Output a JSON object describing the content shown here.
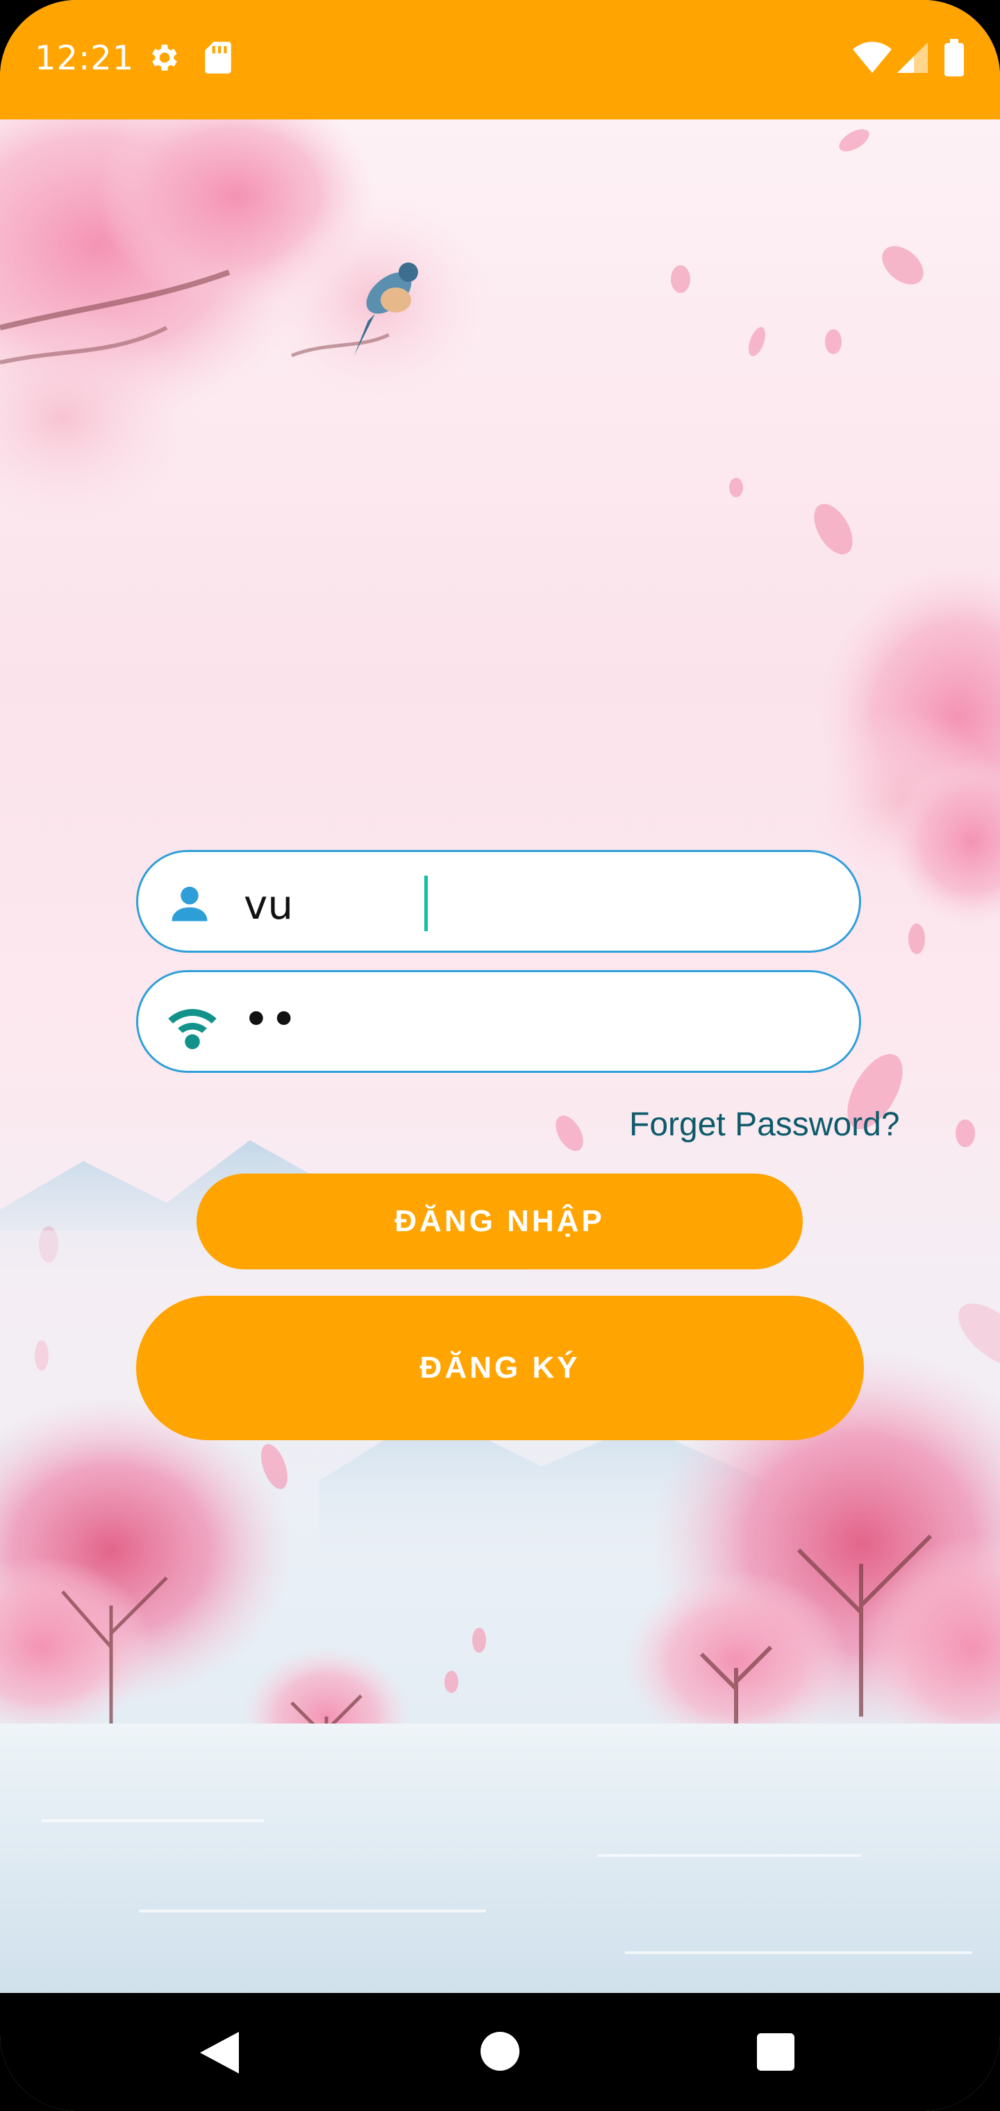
{
  "status_bar": {
    "time": "12:21",
    "icons": [
      "gear-icon",
      "sd-card-icon",
      "wifi-icon",
      "signal-icon",
      "battery-icon"
    ],
    "background": "#ffa400"
  },
  "login_form": {
    "username": {
      "value": "vu",
      "icon": "person-icon"
    },
    "password": {
      "value": "••",
      "icon": "wifi-key-icon"
    },
    "forgot_password_label": "Forget Password?",
    "login_label": "ĐĂNG NHẬP",
    "register_label": "ĐĂNG KÝ"
  },
  "colors": {
    "accent": "#ffa400",
    "field_border": "#2f9fd8",
    "link": "#0d5a6b",
    "caret": "#12bfa6"
  },
  "nav_bar": {
    "buttons": [
      "back-icon",
      "home-icon",
      "recents-icon"
    ]
  }
}
